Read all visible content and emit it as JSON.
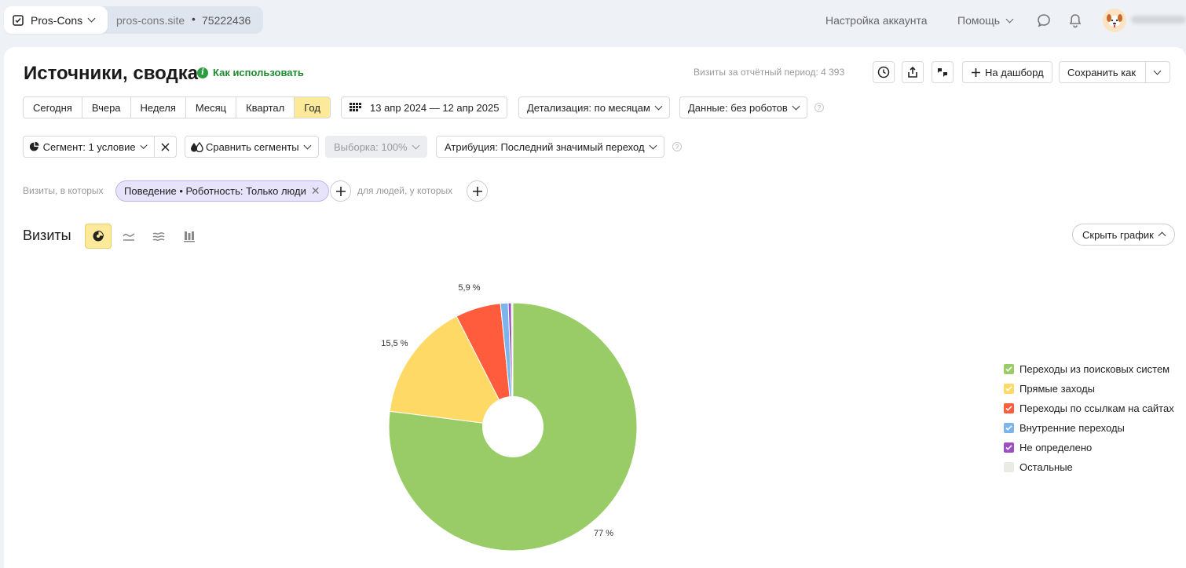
{
  "topbar": {
    "site_name": "Pros-Cons",
    "domain": "pros-cons.site",
    "separator": "•",
    "counter_id": "75222436",
    "account_settings": "Настройка аккаунта",
    "help": "Помощь"
  },
  "header": {
    "title": "Источники, сводка",
    "how_to_use": "Как использовать",
    "visits_period": "Визиты за отчётный период: 4 393",
    "to_dashboard": "На дашборд",
    "save_as": "Сохранить как"
  },
  "periods": [
    "Сегодня",
    "Вчера",
    "Неделя",
    "Месяц",
    "Квартал",
    "Год"
  ],
  "active_period": "Год",
  "date_range": "13 апр 2024 — 12 апр 2025",
  "detail": "Детализация: по месяцам",
  "data_mode": "Данные: без роботов",
  "segment": "Сегмент: 1 условие",
  "compare": "Сравнить сегменты",
  "sample": "Выборка: 100%",
  "attribution": "Атрибуция: Последний значимый переход",
  "filters": {
    "visits_in": "Визиты, в которых",
    "chip": "Поведение • Роботность: Только люди",
    "for_people": "для людей, у которых"
  },
  "chart": {
    "title": "Визиты",
    "hide_chart": "Скрыть график"
  },
  "chart_data": {
    "type": "pie",
    "title": "Визиты",
    "categories": [
      "Переходы из поисковых систем",
      "Прямые заходы",
      "Переходы по ссылкам на сайтах",
      "Внутренние переходы",
      "Не определено",
      "Остальные"
    ],
    "values": [
      77,
      15.5,
      5.9,
      1.0,
      0.4,
      0.2
    ],
    "labels": [
      "77 %",
      "15,5 %",
      "5,9 %",
      "",
      "",
      ""
    ],
    "colors": [
      "#99cc66",
      "#ffd966",
      "#ff5b3d",
      "#7cb5ec",
      "#9b4fc1",
      "#ebebe6"
    ],
    "donut": true,
    "legend_position": "right"
  }
}
